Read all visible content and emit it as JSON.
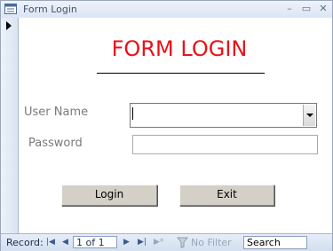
{
  "window": {
    "title": "Form Login",
    "minimize_glyph": "–",
    "restore_glyph": "▭",
    "close_glyph": "✕"
  },
  "form": {
    "heading": "FORM LOGIN",
    "username_label": "User Name",
    "username_value": "",
    "password_label": "Password",
    "password_value": "",
    "login_button": "Login",
    "exit_button": "Exit"
  },
  "navigation": {
    "record_label": "Record:",
    "first_glyph": "|◀",
    "prev_glyph": "◀",
    "record_value": "1 of 1",
    "next_glyph": "▶",
    "last_glyph": "▶|",
    "new_glyph": "▶*",
    "no_filter_label": "No Filter",
    "search_placeholder": "Search"
  },
  "colors": {
    "heading": "#e8121a",
    "label": "#7a7a7a",
    "button_face": "#d4d0c8",
    "nav_bg": "#dbe5f3"
  },
  "icons": {
    "title_icon": "form-icon",
    "record_selector": "current-record-arrow-icon",
    "filter_icon": "filter-icon"
  }
}
